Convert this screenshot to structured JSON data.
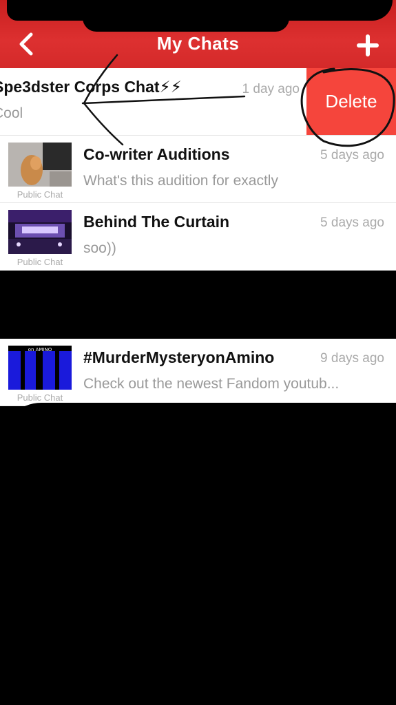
{
  "header": {
    "title": "My Chats",
    "back_icon": "chevron-left-icon",
    "add_icon": "plus-icon",
    "color": "#d42a2a"
  },
  "swiped_chat": {
    "name": "Spe3dster Corps Chat⚡⚡",
    "time": "1 day ago",
    "preview": "Cool",
    "delete_label": "Delete",
    "delete_color": "#f5453c"
  },
  "chats": [
    {
      "name": "Co-writer Auditions",
      "time": "5 days ago",
      "preview": "What's this audition for exactly",
      "thumb_label": "Public Chat"
    },
    {
      "name": "Behind The Curtain",
      "time": "5 days ago",
      "preview": "soo))",
      "thumb_label": "Public Chat"
    },
    {
      "name": "#MurderMysteryonAmino",
      "time": "9 days ago",
      "preview": "Check out the newest Fandom  youtub...",
      "thumb_label": "Public Chat",
      "thumb_text": "on AMINO"
    }
  ]
}
